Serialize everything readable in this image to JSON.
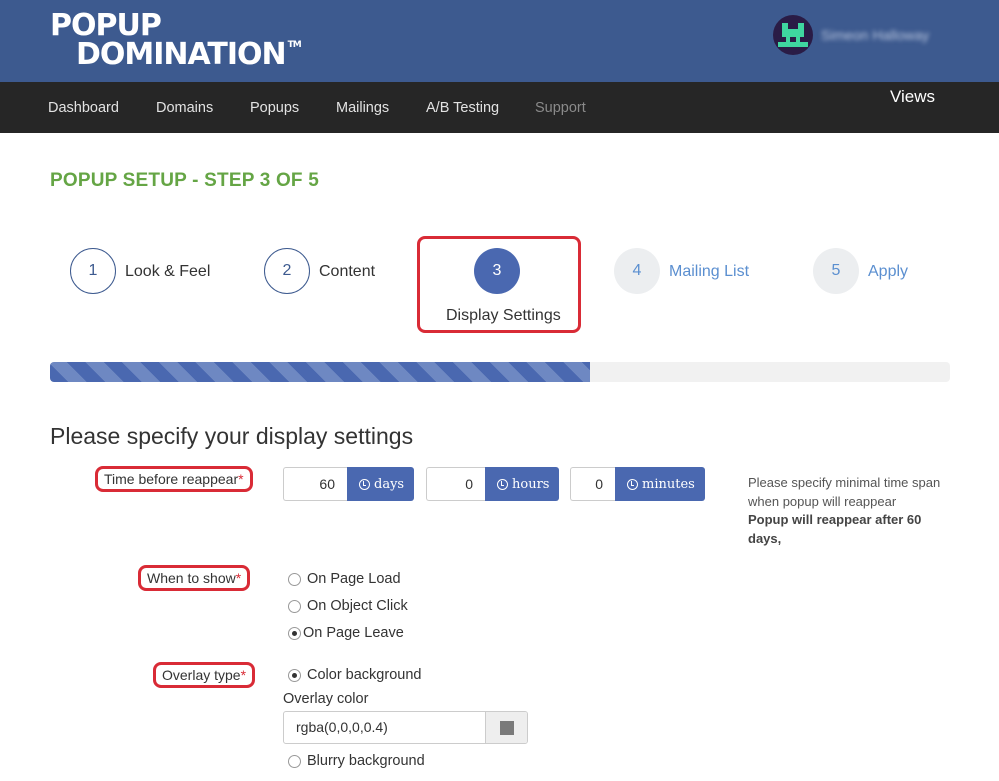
{
  "header": {
    "logo_line1": "POPUP",
    "logo_line2": "DOMINATION",
    "logo_tm": "TM",
    "user_name": "Simeon Halloway"
  },
  "nav": {
    "items": [
      "Dashboard",
      "Domains",
      "Popups",
      "Mailings",
      "A/B Testing",
      "Support"
    ],
    "views_label": "Views"
  },
  "page_title": "POPUP SETUP - STEP 3 OF 5",
  "steps": [
    {
      "number": "1",
      "label": "Look & Feel"
    },
    {
      "number": "2",
      "label": "Content"
    },
    {
      "number": "3",
      "label": "Display Settings"
    },
    {
      "number": "4",
      "label": "Mailing List"
    },
    {
      "number": "5",
      "label": "Apply"
    }
  ],
  "progress_percent": 60,
  "section_heading": "Please specify your display settings",
  "time_before_reappear": {
    "label": "Time before reappear",
    "required_mark": "*",
    "days_value": "60",
    "days_unit": "days",
    "hours_value": "0",
    "hours_unit": "hours",
    "minutes_value": "0",
    "minutes_unit": "minutes",
    "help_text": "Please specify minimal time span when popup will reappear",
    "help_bold": "Popup will reappear after 60 days,"
  },
  "when_to_show": {
    "label": "When to show",
    "required_mark": "*",
    "options": [
      "On Page Load",
      "On Object Click",
      "On Page Leave"
    ],
    "selected": "On Page Leave"
  },
  "overlay_type": {
    "label": "Overlay type",
    "required_mark": "*",
    "option_color": "Color background",
    "overlay_color_label": "Overlay color",
    "overlay_color_value": "rgba(0,0,0,0.4)",
    "option_blurry": "Blurry background",
    "selected": "Color background"
  },
  "colors": {
    "header_bg": "#3d5a8f",
    "nav_bg": "#262626",
    "accent_blue": "#4a68b0",
    "title_green": "#65a545",
    "highlight_red": "#d92b36"
  },
  "icons": [
    "clock-icon",
    "color-swatch-icon",
    "avatar"
  ]
}
